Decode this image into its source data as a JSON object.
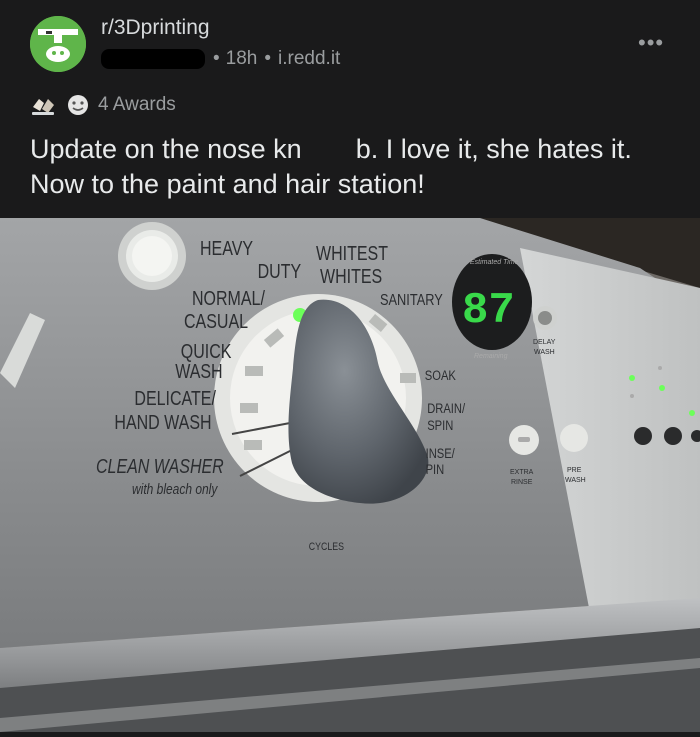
{
  "post": {
    "subreddit": "r/3Dprinting",
    "age": "18h",
    "domain": "i.redd.it",
    "separator": "•",
    "more_label": "•••",
    "awards_label": "4 Awards",
    "title": "Update on the nose kn  b. I love it, she hates it. Now to the paint and hair station!"
  },
  "washer": {
    "cycles": {
      "heavy_duty_1": "HEAVY",
      "heavy_duty_2": "DUTY",
      "whitest_1": "WHITEST",
      "whitest_2": "WHITES",
      "normal_1": "NORMAL/",
      "normal_2": "CASUAL",
      "quick_1": "QUICK",
      "quick_2": "WASH",
      "delicate_1": "DELICATE/",
      "delicate_2": "HAND WASH",
      "clean_washer": "CLEAN WASHER",
      "with_bleach": "with bleach only",
      "sanitary": "SANITARY",
      "soak": "SOAK",
      "drain_1": "DRAIN/",
      "drain_2": "SPIN",
      "rinse_1": "INSE/",
      "rinse_2": "PIN",
      "cycles_label": "CYCLES"
    },
    "display": {
      "value": "87",
      "estimated_time": "Estimated Time",
      "remaining": "Remaining"
    },
    "buttons": {
      "delay_wash_1": "DELAY",
      "delay_wash_2": "WASH",
      "extra_rinse_1": "EXTRA",
      "extra_rinse_2": "RINSE",
      "pre_wash_1": "PRE",
      "pre_wash_2": "WASH"
    },
    "colors": {
      "display_digits": "#39d94a",
      "indicator": "#6cff5a",
      "panel": "#8c8e90"
    }
  }
}
